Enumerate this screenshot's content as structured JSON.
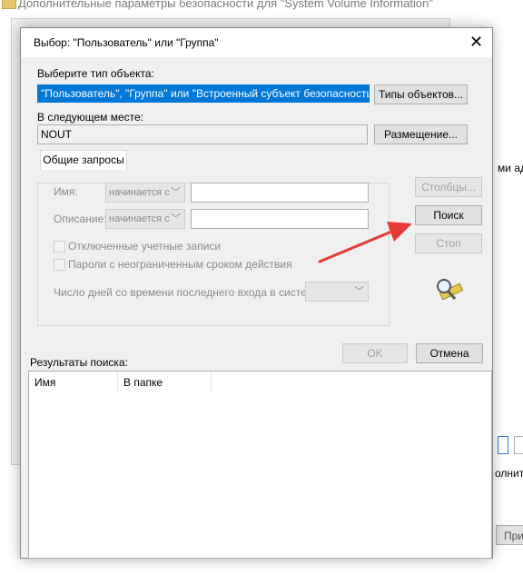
{
  "background": {
    "title": "Дополнительные параметры безопасности  для \"System Volume Information\"",
    "right_text_1": "ми адм",
    "right_text_2": "олнител",
    "right_button": "При"
  },
  "dialog": {
    "title": "Выбор: \"Пользователь\" или \"Группа\"",
    "object_type_label": "Выберите тип объекта:",
    "object_type_value": "\"Пользователь\", \"Группа\" или \"Встроенный субъект безопасности\"",
    "object_types_button": "Типы объектов...",
    "location_label": "В следующем месте:",
    "location_value": "NOUT",
    "location_button": "Размещение...",
    "tab_label": "Общие запросы",
    "name_label": "Имя:",
    "name_combo": "начинается с",
    "description_label": "Описание:",
    "description_combo": "начинается с",
    "disabled_accounts_label": "Отключенные учетные записи",
    "non_expiring_passwords_label": "Пароли с неограниченным сроком действия",
    "days_since_login_label": "Число дней со времени последнего входа в систему:",
    "columns_button": "Столбцы...",
    "search_button": "Поиск",
    "stop_button": "Стоп",
    "ok_button": "OK",
    "cancel_button": "Отмена",
    "results_label": "Результаты поиска:",
    "results_columns": [
      "Имя",
      "В папке"
    ]
  },
  "colors": {
    "selection": "#0078d7",
    "arrow": "#e53935"
  }
}
